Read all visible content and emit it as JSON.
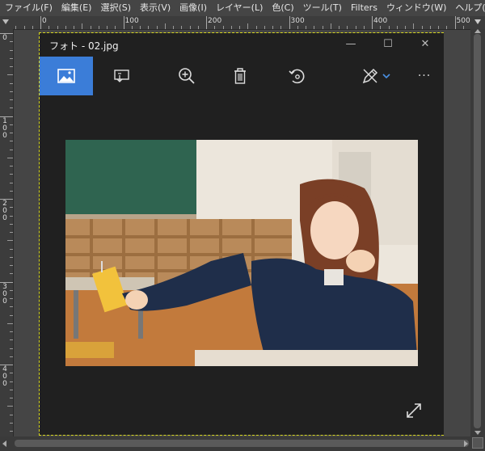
{
  "menubar": {
    "items": [
      "ファイル(F)",
      "編集(E)",
      "選択(S)",
      "表示(V)",
      "画像(I)",
      "レイヤー(L)",
      "色(C)",
      "ツール(T)",
      "Filters",
      "ウィンドウ(W)",
      "ヘルプ(H)"
    ]
  },
  "rulers": {
    "h_labels": [
      "0",
      "100",
      "200",
      "300",
      "400",
      "500"
    ],
    "v_labels": [
      "0",
      "100",
      "200",
      "300",
      "400"
    ]
  },
  "photos_window": {
    "title": "フォト - 02.jpg",
    "minimize_glyph": "—",
    "maximize_glyph": "☐",
    "close_glyph": "✕",
    "more_glyph": "···",
    "accent_color": "#3b7dd8",
    "toolbar": {
      "buttons": [
        {
          "name": "image-view",
          "icon": "image-icon",
          "active": true
        },
        {
          "name": "slideshow",
          "icon": "slideshow-icon",
          "active": false
        },
        {
          "name": "zoom",
          "icon": "zoom-in-icon",
          "active": false
        },
        {
          "name": "delete",
          "icon": "trash-icon",
          "active": false
        },
        {
          "name": "rotate",
          "icon": "rotate-icon",
          "active": false
        },
        {
          "name": "edit-draw",
          "icon": "edit-pen-icon",
          "active": false
        },
        {
          "name": "more",
          "icon": "more-icon",
          "active": false
        }
      ]
    },
    "photo": {
      "description_icon": "photo-image"
    },
    "expand_icon": "expand-icon"
  },
  "colors": {
    "gimp_bg": "#454545",
    "photos_bg": "#202020",
    "selection_dash": "#d8d81e"
  }
}
